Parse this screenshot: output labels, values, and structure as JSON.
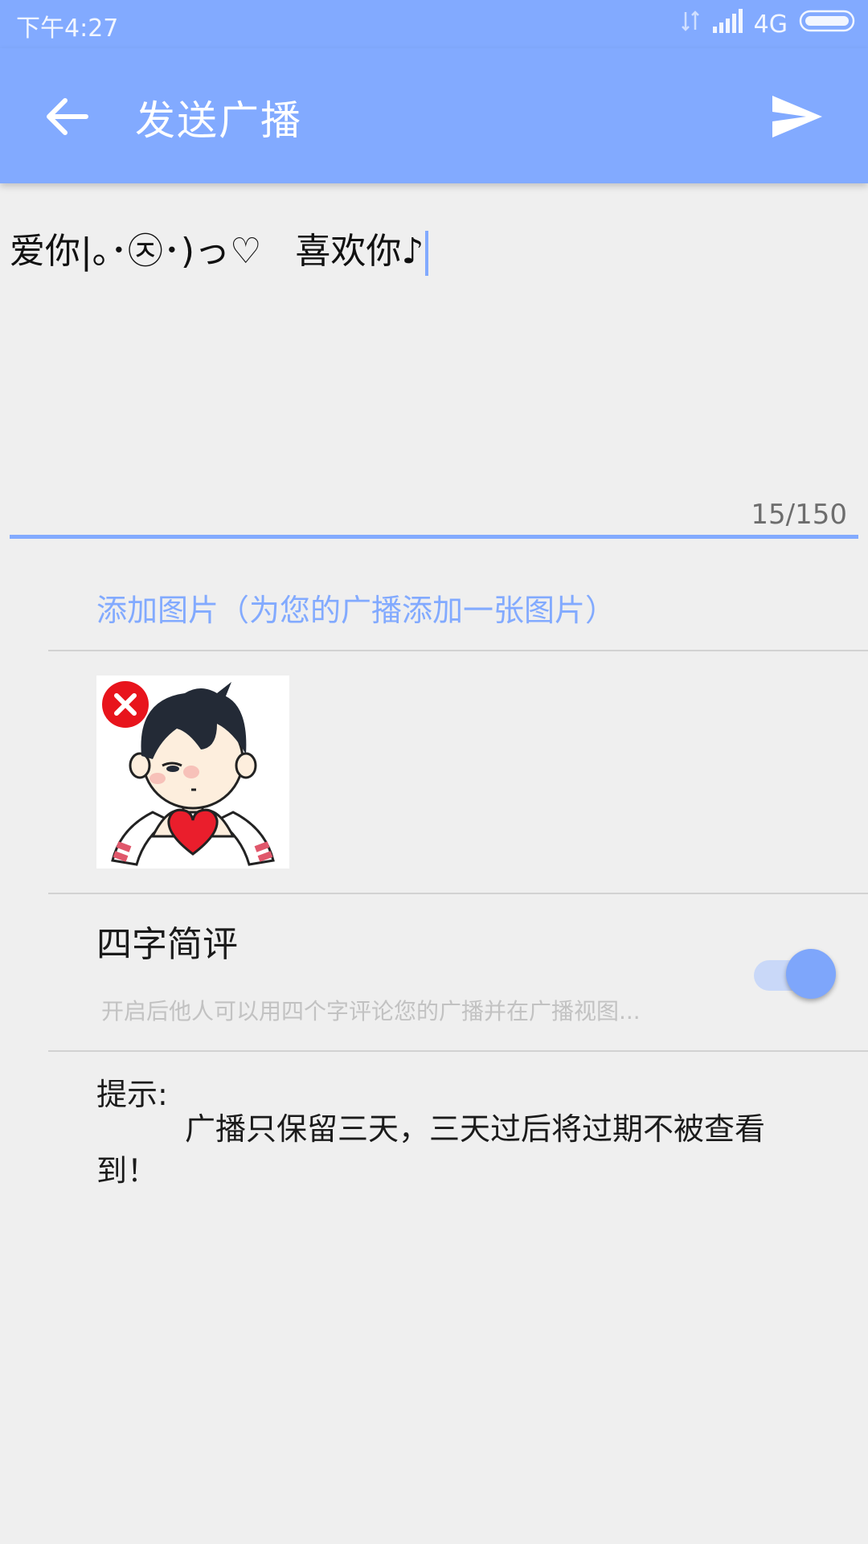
{
  "status_bar": {
    "time": "下午4:27",
    "network": "4G",
    "icons": [
      "data-arrows-icon",
      "signal-icon",
      "battery-icon"
    ]
  },
  "toolbar": {
    "title": "发送广播",
    "back_icon": "arrow-left-icon",
    "send_icon": "send-icon",
    "background": "#82aaff"
  },
  "editor": {
    "value": "爱你|｡･㉨･)っ♡   喜欢你♪",
    "counter": "15/150",
    "accent": "#82aaff"
  },
  "add_image": {
    "label": "添加图片（为您的广播添加一张图片）"
  },
  "attachment": {
    "image": "cartoon-boy-heart-image",
    "remove_icon": "remove-x-icon"
  },
  "four_char_review": {
    "title": "四字简评",
    "description": "开启后他人可以用四个字评论您的广播并在广播视图...",
    "enabled": true
  },
  "hint": {
    "label": "提示:",
    "text": "广播只保留三天，三天过后将过期不被查看到！"
  }
}
